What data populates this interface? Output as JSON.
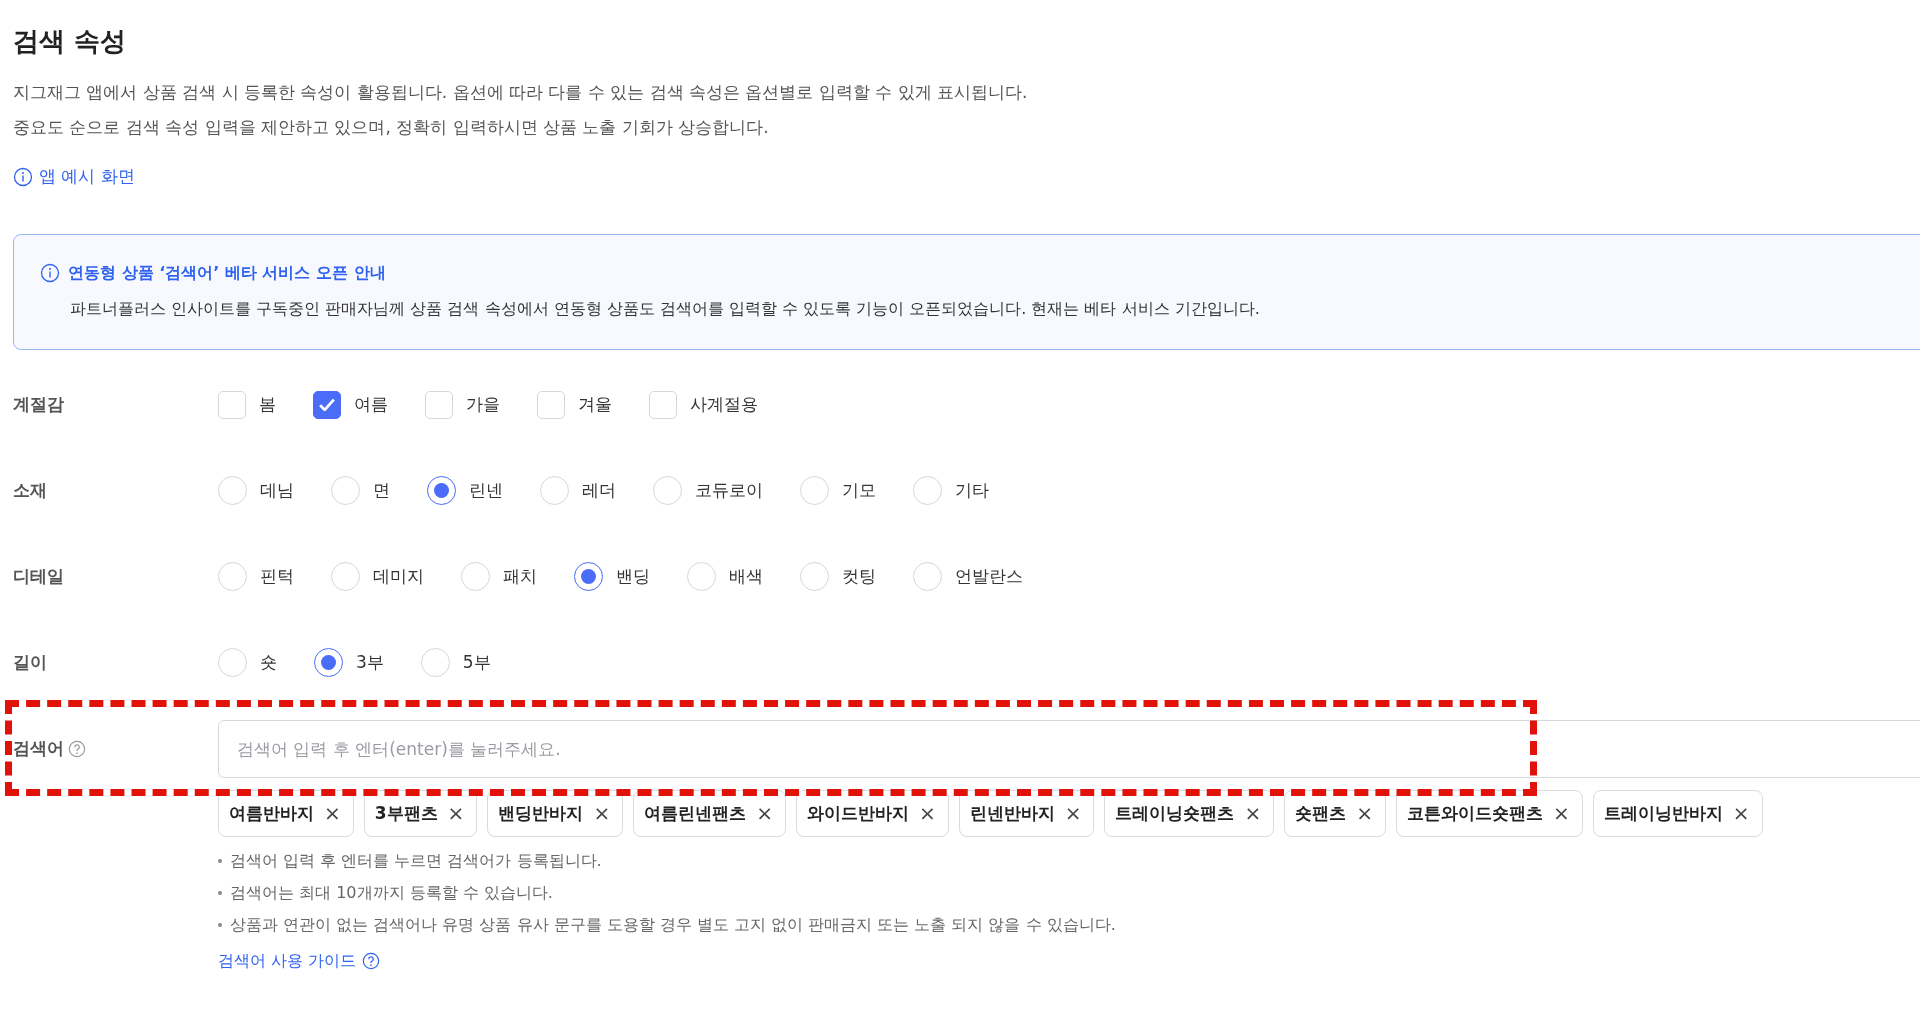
{
  "title": "검색 속성",
  "description": [
    "지그재그 앱에서 상품 검색 시 등록한 속성이 활용됩니다. 옵션에 따라 다를 수 있는 검색 속성은 옵션별로 입력할 수 있게 표시됩니다.",
    "중요도 순으로 검색 속성 입력을 제안하고 있으며, 정확히 입력하시면 상품 노출 기회가 상승합니다."
  ],
  "example_link": "앱 예시 화면",
  "notice": {
    "title": "연동형 상품 ‘검색어’ 베타 서비스 오픈 안내",
    "text": "파트너플러스 인사이트를 구독중인 판매자님께 상품 검색 속성에서 연동형 상품도 검색어를 입력할 수 있도록 기능이 오픈되었습니다. 현재는 베타 서비스 기간입니다."
  },
  "attributes": [
    {
      "label": "계절감",
      "kind": "checkbox",
      "options": [
        {
          "label": "봄",
          "selected": false
        },
        {
          "label": "여름",
          "selected": true
        },
        {
          "label": "가을",
          "selected": false
        },
        {
          "label": "겨울",
          "selected": false
        },
        {
          "label": "사계절용",
          "selected": false
        }
      ]
    },
    {
      "label": "소재",
      "kind": "radio",
      "options": [
        {
          "label": "데님",
          "selected": false
        },
        {
          "label": "면",
          "selected": false
        },
        {
          "label": "린넨",
          "selected": true
        },
        {
          "label": "레더",
          "selected": false
        },
        {
          "label": "코듀로이",
          "selected": false
        },
        {
          "label": "기모",
          "selected": false
        },
        {
          "label": "기타",
          "selected": false
        }
      ]
    },
    {
      "label": "디테일",
      "kind": "radio",
      "options": [
        {
          "label": "핀턱",
          "selected": false
        },
        {
          "label": "데미지",
          "selected": false
        },
        {
          "label": "패치",
          "selected": false
        },
        {
          "label": "밴딩",
          "selected": true
        },
        {
          "label": "배색",
          "selected": false
        },
        {
          "label": "컷팅",
          "selected": false
        },
        {
          "label": "언발란스",
          "selected": false
        }
      ]
    },
    {
      "label": "길이",
      "kind": "radio",
      "options": [
        {
          "label": "숏",
          "selected": false
        },
        {
          "label": "3부",
          "selected": true
        },
        {
          "label": "5부",
          "selected": false
        }
      ]
    }
  ],
  "keywords": {
    "label": "검색어",
    "highlighted": true,
    "placeholder": "검색어 입력 후 엔터(enter)를 눌러주세요.",
    "tags": [
      {
        "label": "여름반바지",
        "remove": "×"
      },
      {
        "label": "3부팬츠",
        "remove": "×"
      },
      {
        "label": "밴딩반바지",
        "remove": "×"
      },
      {
        "label": "여름린넨팬츠",
        "remove": "×"
      },
      {
        "label": "와이드반바지",
        "remove": "×"
      },
      {
        "label": "린넨반바지",
        "remove": "×"
      },
      {
        "label": "트레이닝숏팬츠",
        "remove": "×"
      },
      {
        "label": "숏팬츠",
        "remove": "×"
      },
      {
        "label": "코튼와이드숏팬츠",
        "remove": "×"
      },
      {
        "label": "트레이닝반바지",
        "remove": "×"
      }
    ],
    "notes": [
      "검색어 입력 후 엔터를 누르면 검색어가 등록됩니다.",
      "검색어는 최대 10개까지 등록할 수 있습니다.",
      "상품과 연관이 없는 검색어나 유명 상품 유사 문구를 도용할 경우 별도 고지 없이 판매금지 또는 노출 되지 않을 수 있습니다."
    ],
    "guide_link": "검색어 사용 가이드"
  }
}
